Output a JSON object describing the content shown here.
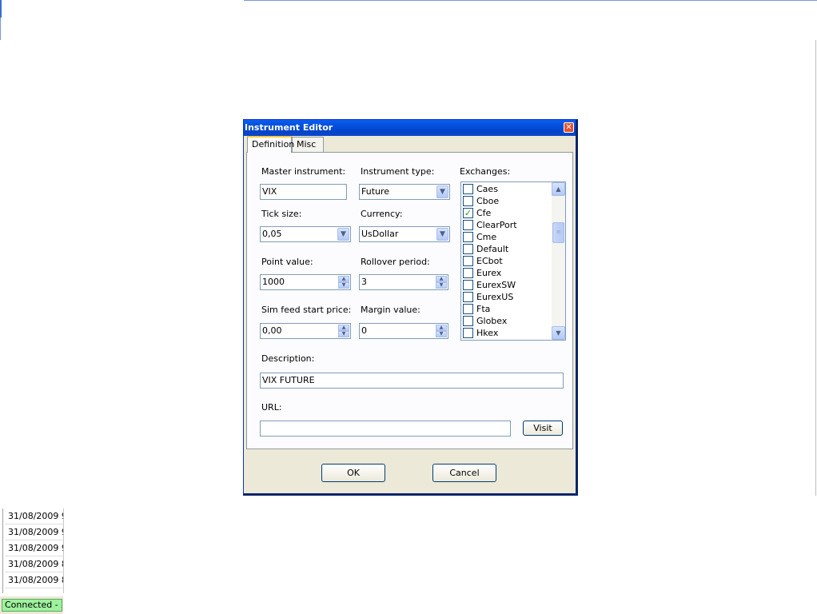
{
  "background": {
    "grid_rows": [
      "31/08/2009 9",
      "31/08/2009 9",
      "31/08/2009 9",
      "31/08/2009 8",
      "31/08/2009 8"
    ],
    "status_text": "Connected - Ze"
  },
  "dialog": {
    "title": "Instrument Editor",
    "close_icon": "close-icon",
    "tabs": [
      {
        "label": "Definition",
        "active": true
      },
      {
        "label": "Misc",
        "active": false
      }
    ],
    "definition": {
      "master_instrument": {
        "label": "Master instrument:",
        "value": "VIX"
      },
      "instrument_type": {
        "label": "Instrument type:",
        "value": "Future"
      },
      "exchanges": {
        "label": "Exchanges:",
        "items": [
          {
            "name": "Caes",
            "checked": false
          },
          {
            "name": "Cboe",
            "checked": false
          },
          {
            "name": "Cfe",
            "checked": true
          },
          {
            "name": "ClearPort",
            "checked": false
          },
          {
            "name": "Cme",
            "checked": false
          },
          {
            "name": "Default",
            "checked": false
          },
          {
            "name": "ECbot",
            "checked": false
          },
          {
            "name": "Eurex",
            "checked": false
          },
          {
            "name": "EurexSW",
            "checked": false
          },
          {
            "name": "EurexUS",
            "checked": false
          },
          {
            "name": "Fta",
            "checked": false
          },
          {
            "name": "Globex",
            "checked": false
          },
          {
            "name": "Hkex",
            "checked": false
          }
        ]
      },
      "tick_size": {
        "label": "Tick size:",
        "value": "0,05"
      },
      "currency": {
        "label": "Currency:",
        "value": "UsDollar"
      },
      "point_value": {
        "label": "Point value:",
        "value": "1000"
      },
      "rollover_period": {
        "label": "Rollover period:",
        "value": "3"
      },
      "sim_feed_start_price": {
        "label": "Sim feed start price:",
        "value": "0,00"
      },
      "margin_value": {
        "label": "Margin value:",
        "value": "0"
      },
      "description": {
        "label": "Description:",
        "value": "VIX FUTURE"
      },
      "url": {
        "label": "URL:",
        "value": ""
      },
      "visit_label": "Visit"
    },
    "ok_label": "OK",
    "cancel_label": "Cancel"
  }
}
